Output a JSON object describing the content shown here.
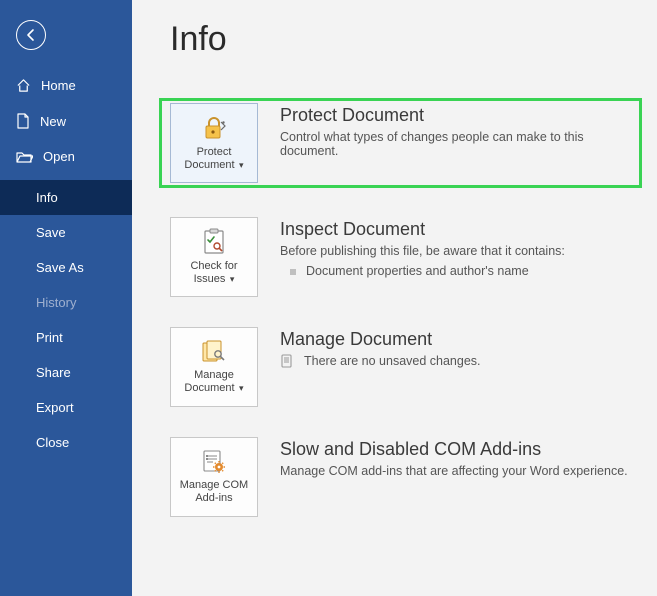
{
  "page": {
    "title": "Info"
  },
  "sidebar": {
    "top": [
      {
        "label": "Home"
      },
      {
        "label": "New"
      },
      {
        "label": "Open"
      }
    ],
    "sub": [
      {
        "label": "Info",
        "active": true
      },
      {
        "label": "Save"
      },
      {
        "label": "Save As"
      },
      {
        "label": "History",
        "disabled": true
      },
      {
        "label": "Print"
      },
      {
        "label": "Share"
      },
      {
        "label": "Export"
      },
      {
        "label": "Close"
      }
    ]
  },
  "sections": {
    "protect": {
      "tile_label": "Protect Document",
      "title": "Protect Document",
      "desc": "Control what types of changes people can make to this document."
    },
    "inspect": {
      "tile_label": "Check for Issues",
      "title": "Inspect Document",
      "desc": "Before publishing this file, be aware that it contains:",
      "bullets": [
        "Document properties and author's name"
      ]
    },
    "manage": {
      "tile_label": "Manage Document",
      "title": "Manage Document",
      "desc": "There are no unsaved changes."
    },
    "addins": {
      "tile_label": "Manage COM Add-ins",
      "title": "Slow and Disabled COM Add-ins",
      "desc": "Manage COM add-ins that are affecting your Word experience."
    }
  }
}
